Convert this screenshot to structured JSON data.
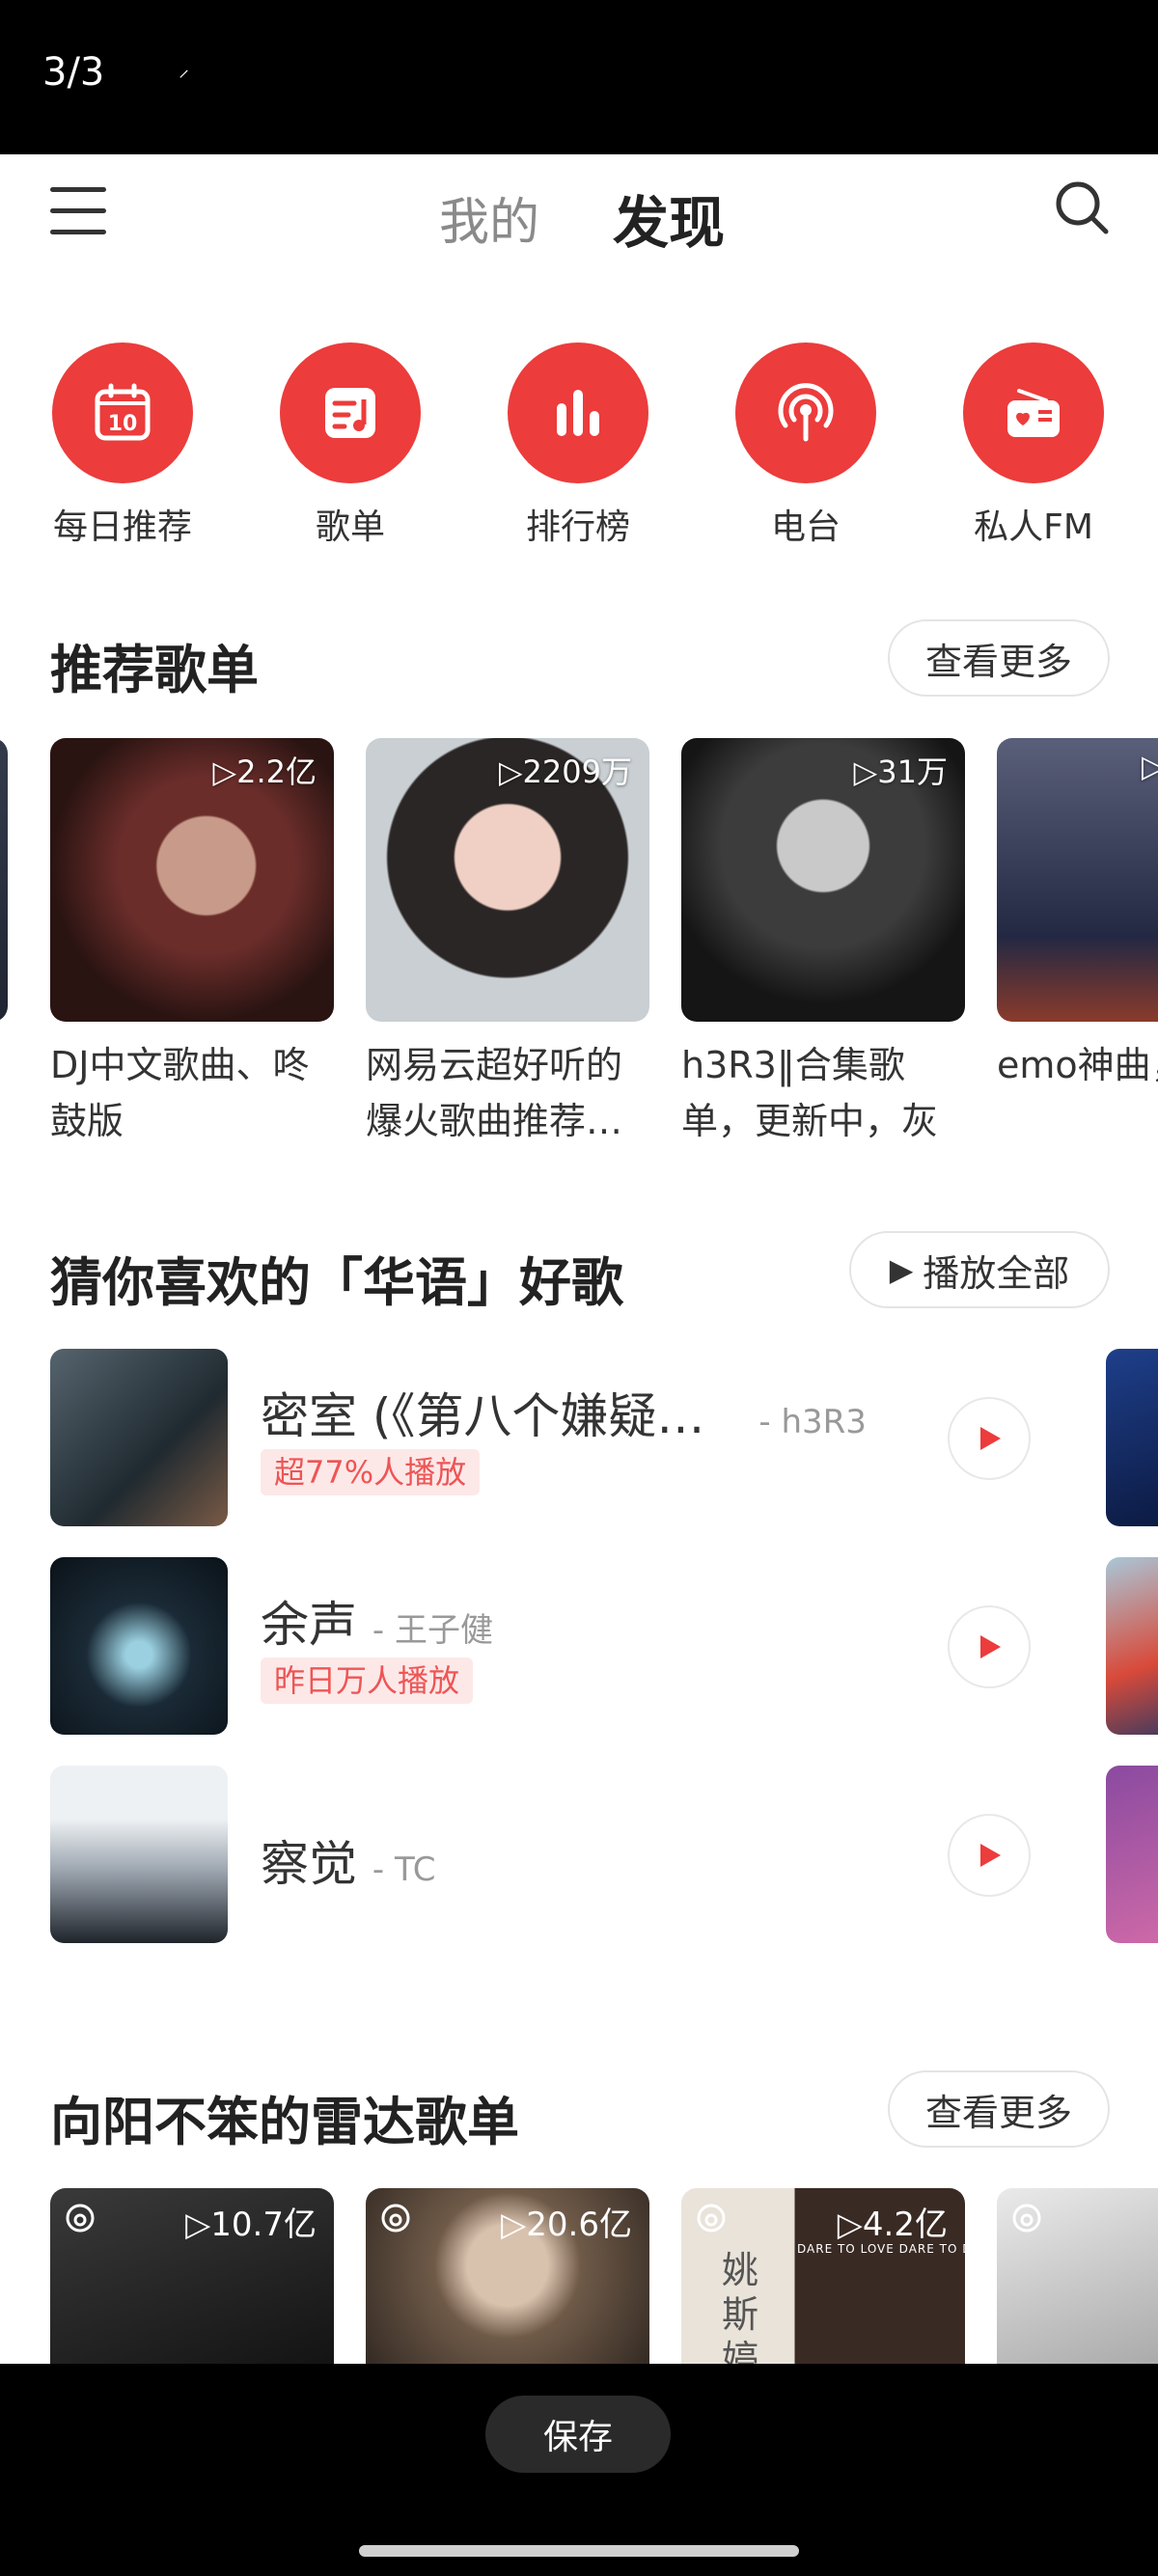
{
  "status": {
    "counter": "3/3",
    "mini_icon": "⸝"
  },
  "header": {
    "tab_mine": "我的",
    "tab_discover": "发现"
  },
  "quick_access": [
    {
      "label": "每日推荐",
      "icon": "calendar-icon",
      "badge": "10"
    },
    {
      "label": "歌单",
      "icon": "playlist-icon"
    },
    {
      "label": "排行榜",
      "icon": "chart-bars-icon"
    },
    {
      "label": "电台",
      "icon": "podcast-icon"
    },
    {
      "label": "私人FM",
      "icon": "radio-icon"
    }
  ],
  "recommended": {
    "title": "推荐歌单",
    "more": "查看更多",
    "cards": [
      {
        "plays": "▷2.2亿",
        "title": "DJ中文歌曲、咚鼓版"
      },
      {
        "plays": "▷2209万",
        "title": "网易云超好听的爆火歌曲推荐…"
      },
      {
        "plays": "▷31万",
        "title": "h3R3‖合集歌单，更新中，灰"
      },
      {
        "plays": "▷",
        "title": "emo神曲，勿听"
      }
    ]
  },
  "guess": {
    "title": "猜你喜欢的「华语」好歌",
    "play_all": "播放全部",
    "songs": [
      {
        "name": "密室 (《第八个嫌疑…",
        "artist": "- h3R3",
        "tag": "超77%人播放"
      },
      {
        "name": "余声",
        "artist": "- 王子健",
        "tag": "昨日万人播放"
      },
      {
        "name": "察觉",
        "artist": "- TC",
        "tag": ""
      }
    ]
  },
  "radar": {
    "title": "向阳不笨的雷达歌单",
    "more": "查看更多",
    "cards": [
      {
        "plays": "▷10.7亿"
      },
      {
        "plays": "▷20.6亿"
      },
      {
        "plays": "▷4.2亿",
        "cover_text": "姚斯婷",
        "banner": "DARE TO LOVE DARE TO DO"
      },
      {
        "plays": ""
      }
    ]
  },
  "bottom": {
    "save_label": "保存"
  },
  "colors": {
    "accent": "#ec3c3c",
    "tag_bg": "#fde8e8",
    "tag_text": "#e55555"
  }
}
